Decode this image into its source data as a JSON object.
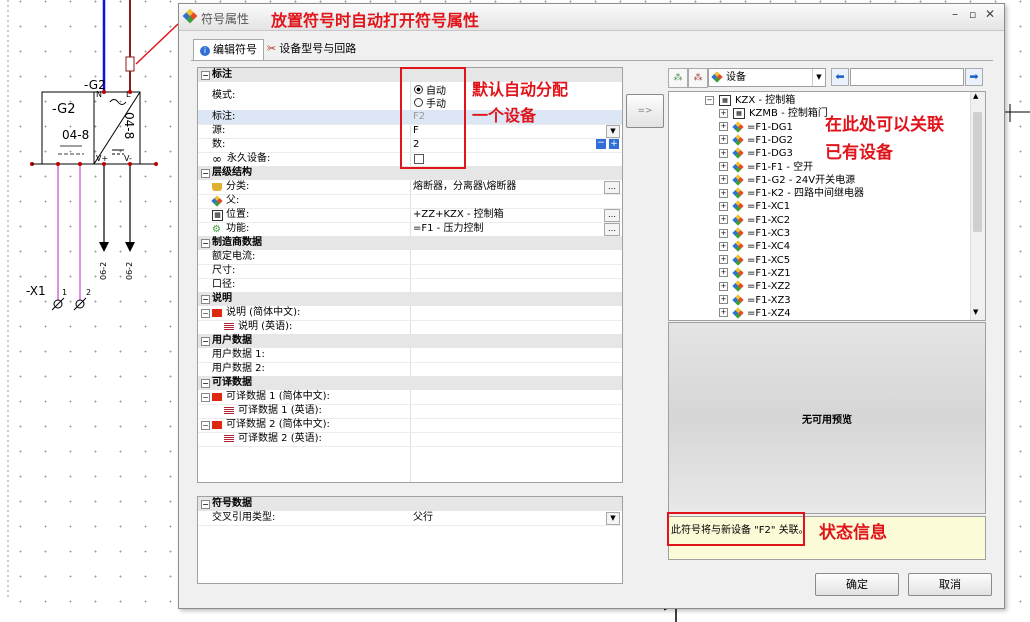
{
  "drawing": {
    "symbol_name": "-G2",
    "symbol_ref": "04-8",
    "side_ref": "04-8",
    "pin_n": "N",
    "pin_l": "L",
    "pin_vplus": "V+",
    "pin_vminus": "V-",
    "top_label": "-G2",
    "arrow_ref_1": "06-2",
    "arrow_ref_2": "06-2",
    "terminal_label": "-X1",
    "terminal_1": "1",
    "terminal_2": "2"
  },
  "dialog": {
    "title": "符号属性",
    "tabs": [
      "编辑符号",
      "设备型号与回路"
    ],
    "sections": {
      "annotation": "标注",
      "hierarchy": "层级结构",
      "manufacturer": "制造商数据",
      "description": "说明",
      "user_data": "用户数据",
      "translatable": "可译数据",
      "symbol_data": "符号数据"
    },
    "fields": {
      "mode": "模式:",
      "mode_auto": "自动",
      "mode_manual": "手动",
      "tag": "标注:",
      "tag_value": "F2",
      "source": "源:",
      "source_value": "F",
      "number": "数:",
      "number_value": "2",
      "permanent": "永久设备:",
      "category": "分类:",
      "category_value": "熔断器，分离器\\熔断器",
      "parent": "父:",
      "location": "位置:",
      "location_value": "+ZZ+KZX - 控制箱",
      "function": "功能:",
      "function_value": "=F1 - 压力控制",
      "rated_current": "额定电流:",
      "size": "尺寸:",
      "caliber": "口径:",
      "desc_zh": "说明 (简体中文):",
      "desc_en": "说明 (英语):",
      "user1": "用户数据 1:",
      "user2": "用户数据 2:",
      "trans1_zh": "可译数据 1 (简体中文):",
      "trans1_en": "可译数据 1 (英语):",
      "trans2_zh": "可译数据 2 (简体中文):",
      "trans2_en": "可译数据 2 (英语):",
      "xref_type": "交叉引用类型:",
      "xref_value": "父行"
    },
    "arrow_button": "=>",
    "device_dropdown": "设备",
    "tree": [
      {
        "label": "KZX - 控制箱",
        "level": 0,
        "expanded": true
      },
      {
        "label": "KZMB - 控制箱门",
        "level": 1
      },
      {
        "label": "=F1-DG1",
        "level": 1
      },
      {
        "label": "=F1-DG2",
        "level": 1
      },
      {
        "label": "=F1-DG3",
        "level": 1
      },
      {
        "label": "=F1-F1 - 空开",
        "level": 1
      },
      {
        "label": "=F1-G2 - 24V开关电源",
        "level": 1
      },
      {
        "label": "=F1-K2 - 四路中间继电器",
        "level": 1
      },
      {
        "label": "=F1-XC1",
        "level": 1
      },
      {
        "label": "=F1-XC2",
        "level": 1
      },
      {
        "label": "=F1-XC3",
        "level": 1
      },
      {
        "label": "=F1-XC4",
        "level": 1
      },
      {
        "label": "=F1-XC5",
        "level": 1
      },
      {
        "label": "=F1-XZ1",
        "level": 1
      },
      {
        "label": "=F1-XZ2",
        "level": 1
      },
      {
        "label": "=F1-XZ3",
        "level": 1
      },
      {
        "label": "=F1-XZ4",
        "level": 1
      }
    ],
    "preview_text": "无可用预览",
    "status_text": "此符号将与新设备 \"F2\" 关联。",
    "ok": "确定",
    "cancel": "取消"
  },
  "annotations": {
    "title_note": "放置符号时自动打开符号属性",
    "auto_note_1": "默认自动分配",
    "auto_note_2": "一个设备",
    "tree_note_1": "在此处可以关联",
    "tree_note_2": "已有设备",
    "status_note": "状态信息"
  },
  "colors": {
    "annotation": "#e0151c",
    "wire_blue": "#1010e0",
    "wire_brown": "#8b1a1a",
    "wire_pink": "#c020c0"
  }
}
